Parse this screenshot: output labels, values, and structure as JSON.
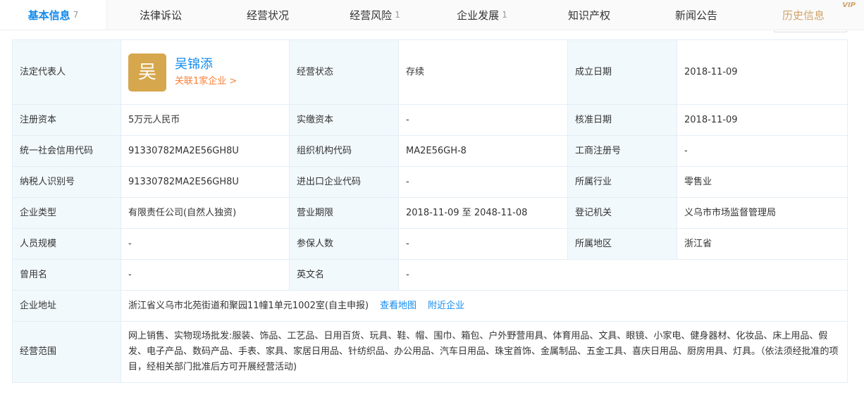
{
  "tabs": [
    {
      "label": "基本信息",
      "count": "7"
    },
    {
      "label": "法律诉讼",
      "count": ""
    },
    {
      "label": "经营状况",
      "count": ""
    },
    {
      "label": "经营风险",
      "count": "1"
    },
    {
      "label": "企业发展",
      "count": "1"
    },
    {
      "label": "知识产权",
      "count": ""
    },
    {
      "label": "新闻公告",
      "count": ""
    },
    {
      "label": "历史信息",
      "count": "",
      "badge": "VIP"
    }
  ],
  "legal_rep": {
    "label": "法定代表人",
    "avatar_char": "吴",
    "name": "吴锦添",
    "link": "关联1家企业 >"
  },
  "rows": {
    "status": {
      "label": "经营状态",
      "value": "存续"
    },
    "established": {
      "label": "成立日期",
      "value": "2018-11-09"
    },
    "reg_capital": {
      "label": "注册资本",
      "value": "5万元人民币"
    },
    "paid_capital": {
      "label": "实缴资本",
      "value": "-"
    },
    "approved": {
      "label": "核准日期",
      "value": "2018-11-09"
    },
    "credit_code": {
      "label": "统一社会信用代码",
      "value": "91330782MA2E56GH8U"
    },
    "org_code": {
      "label": "组织机构代码",
      "value": "MA2E56GH-8"
    },
    "biz_reg_no": {
      "label": "工商注册号",
      "value": "-"
    },
    "taxpayer_id": {
      "label": "纳税人识别号",
      "value": "91330782MA2E56GH8U"
    },
    "import_export": {
      "label": "进出口企业代码",
      "value": "-"
    },
    "industry": {
      "label": "所属行业",
      "value": "零售业"
    },
    "company_type": {
      "label": "企业类型",
      "value": "有限责任公司(自然人独资)"
    },
    "term": {
      "label": "营业期限",
      "value": "2018-11-09 至 2048-11-08"
    },
    "authority": {
      "label": "登记机关",
      "value": "义乌市市场监督管理局"
    },
    "staff": {
      "label": "人员规模",
      "value": "-"
    },
    "insured": {
      "label": "参保人数",
      "value": "-"
    },
    "region": {
      "label": "所属地区",
      "value": "浙江省"
    },
    "former_name": {
      "label": "曾用名",
      "value": "-"
    },
    "english_name": {
      "label": "英文名",
      "value": "-"
    },
    "address": {
      "label": "企业地址",
      "value": "浙江省义乌市北苑街道和聚园11幢1单元1002室(自主申报)",
      "map_link": "查看地图",
      "nearby_link": "附近企业"
    },
    "scope": {
      "label": "经营范围",
      "value": "网上销售、实物现场批发:服装、饰品、工艺品、日用百货、玩具、鞋、帽、围巾、箱包、户外野营用具、体育用品、文具、眼镜、小家电、健身器材、化妆品、床上用品、假发、电子产品、数码产品、手表、家具、家居日用品、针纺织品、办公用品、汽车日用品、珠宝首饰、金属制品、五金工具、喜庆日用品、厨房用具、灯具。（依法须经批准的项目，经相关部门批准后方可开展经营活动)"
    }
  }
}
